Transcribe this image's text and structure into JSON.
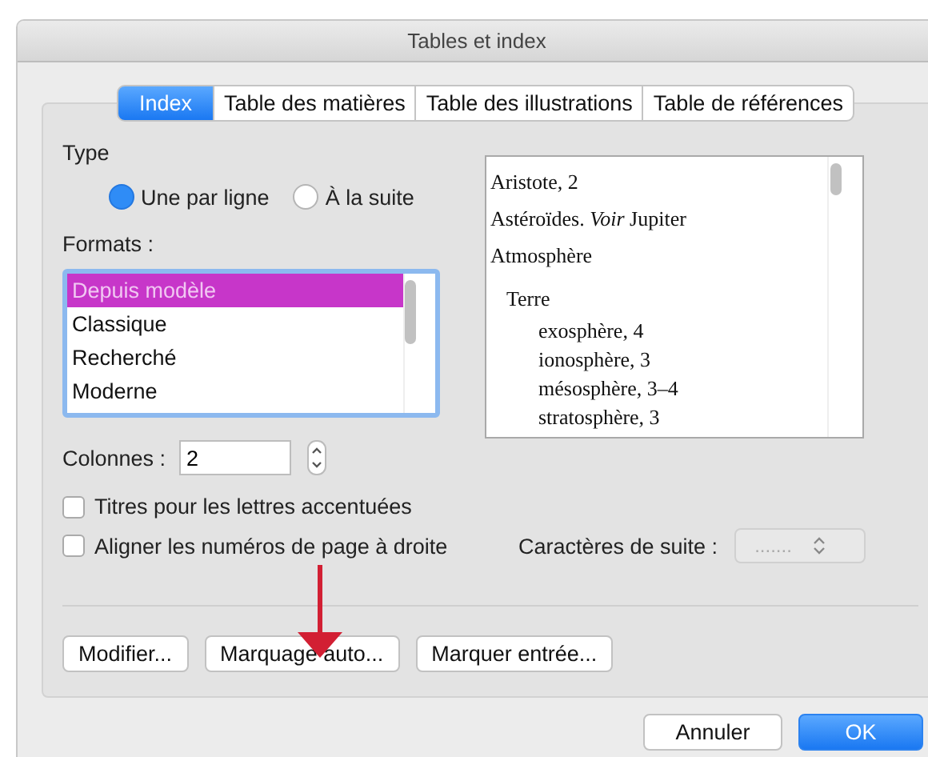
{
  "window": {
    "title": "Tables et index"
  },
  "tabs": [
    {
      "label": "Index",
      "selected": true
    },
    {
      "label": "Table des matières",
      "selected": false
    },
    {
      "label": "Table des illustrations",
      "selected": false
    },
    {
      "label": "Table de références",
      "selected": false
    }
  ],
  "type": {
    "label": "Type",
    "options": [
      {
        "label": "Une par ligne",
        "selected": true
      },
      {
        "label": "À la suite",
        "selected": false
      }
    ]
  },
  "formats": {
    "label": "Formats :",
    "items": [
      {
        "label": "Depuis modèle",
        "selected": true
      },
      {
        "label": "Classique",
        "selected": false
      },
      {
        "label": "Recherché",
        "selected": false
      },
      {
        "label": "Moderne",
        "selected": false
      }
    ]
  },
  "preview": [
    {
      "text": "Aristote, 2"
    },
    {
      "text": "Astéroïdes. *Voir* Jupiter"
    },
    {
      "text": "Atmosphère",
      "children": [
        {
          "text": "Terre",
          "children": [
            {
              "text": "exosphère, 4"
            },
            {
              "text": "ionosphère, 3"
            },
            {
              "text": "mésosphère, 3–4"
            },
            {
              "text": "stratosphère, 3"
            }
          ]
        }
      ]
    }
  ],
  "columns": {
    "label": "Colonnes :",
    "value": "2"
  },
  "checkboxes": [
    {
      "label": "Titres pour les lettres accentuées",
      "checked": false
    },
    {
      "label": "Aligner les numéros de page à droite",
      "checked": false
    }
  ],
  "leader": {
    "label": "Caractères de suite :",
    "value": ".......",
    "disabled": true
  },
  "actions": [
    "Modifier...",
    "Marquage auto...",
    "Marquer entrée..."
  ],
  "footer": [
    {
      "label": "Annuler",
      "kind": "secondary"
    },
    {
      "label": "OK",
      "kind": "primary"
    }
  ]
}
